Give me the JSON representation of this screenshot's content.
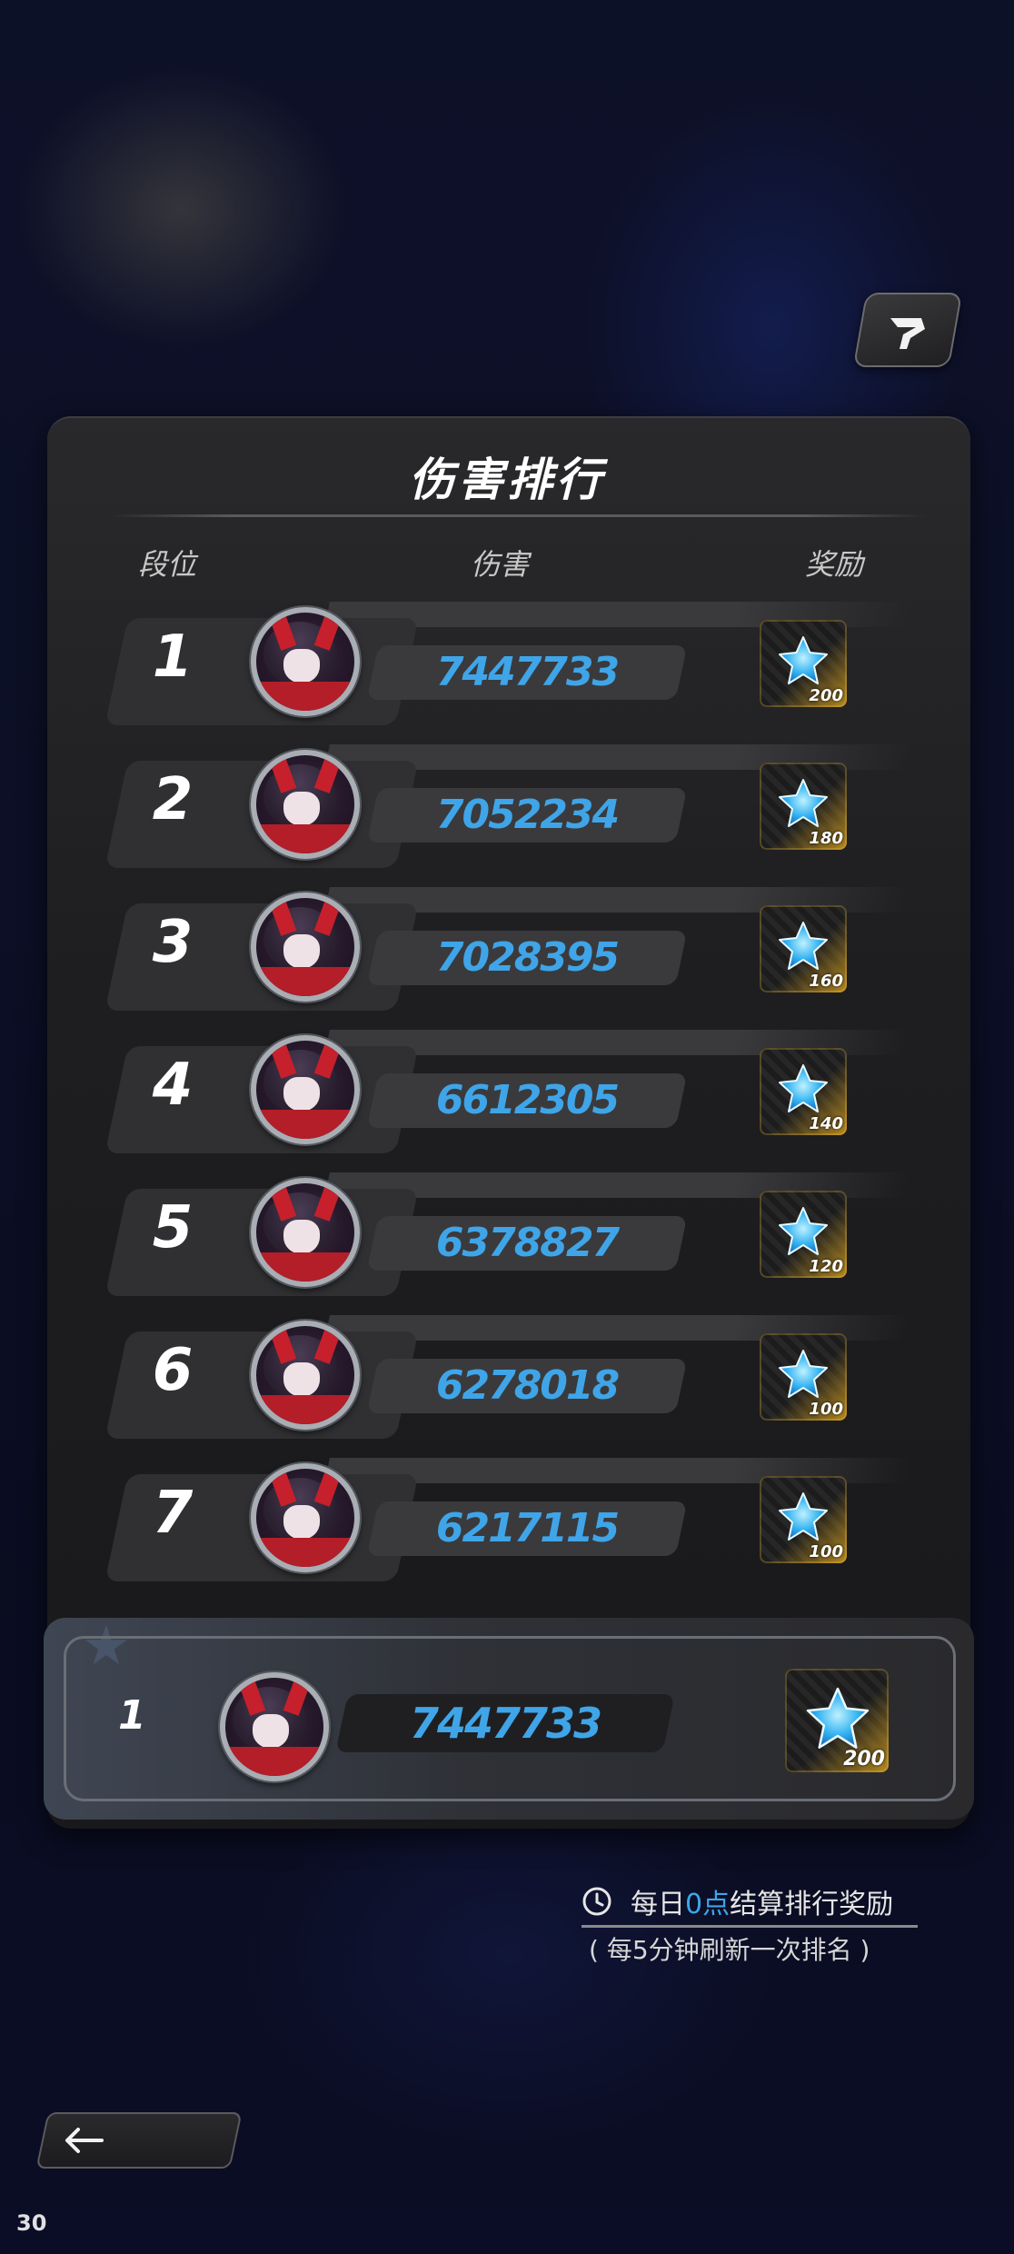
{
  "title": "伤害排行",
  "headers": {
    "rank": "段位",
    "damage": "伤害",
    "reward": "奖励"
  },
  "rows": [
    {
      "rank": "1",
      "damage": "7447733",
      "reward": "200"
    },
    {
      "rank": "2",
      "damage": "7052234",
      "reward": "180"
    },
    {
      "rank": "3",
      "damage": "7028395",
      "reward": "160"
    },
    {
      "rank": "4",
      "damage": "6612305",
      "reward": "140"
    },
    {
      "rank": "5",
      "damage": "6378827",
      "reward": "120"
    },
    {
      "rank": "6",
      "damage": "6278018",
      "reward": "100"
    },
    {
      "rank": "7",
      "damage": "6217115",
      "reward": "100"
    }
  ],
  "my_row": {
    "rank": "1",
    "damage": "7447733",
    "reward": "200"
  },
  "notice": {
    "prefix": "每日",
    "highlight": "0点",
    "suffix": "结算排行奖励",
    "refresh": "( 每5分钟刷新一次排名 )"
  },
  "fps": "30",
  "colors": {
    "accent": "#3fa5e8",
    "panel": "#1e1e20",
    "gold": "#c8961e"
  },
  "icons": {
    "corner": "share-icon",
    "reward": "star-gem-icon",
    "notice": "clock-icon",
    "back": "back-arrow-icon"
  }
}
